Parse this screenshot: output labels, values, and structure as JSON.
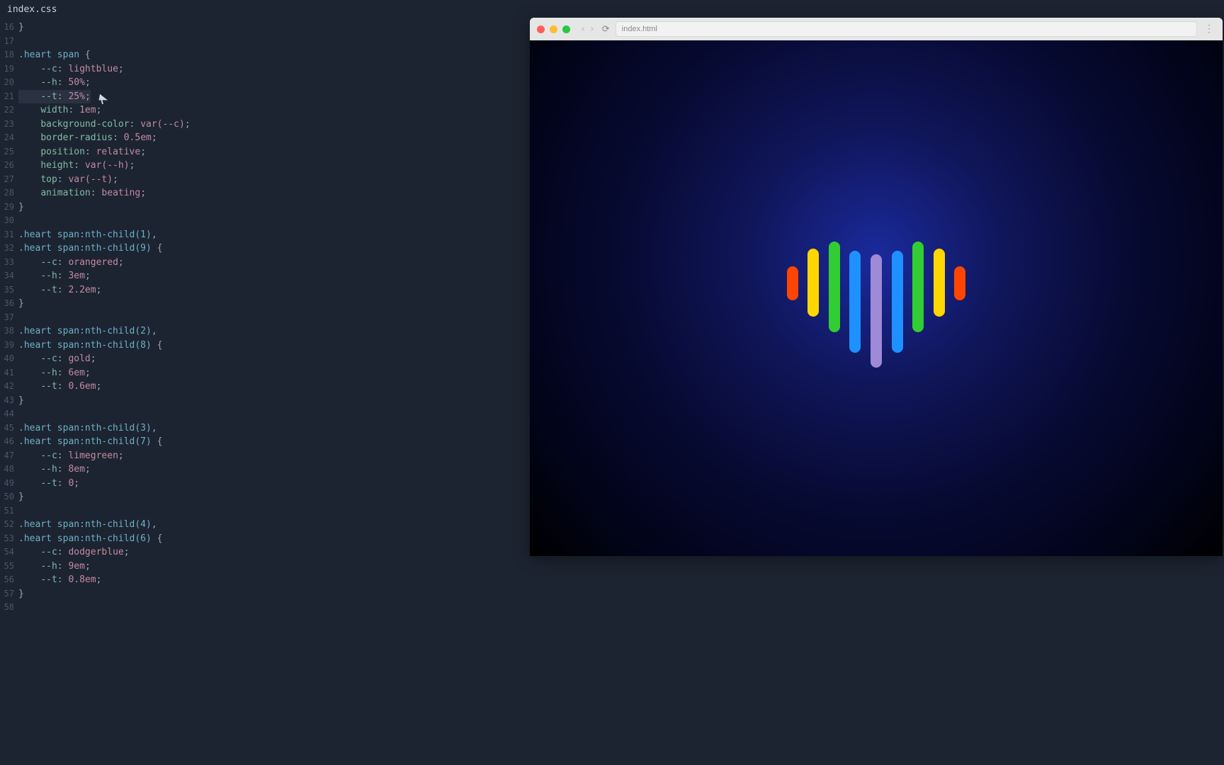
{
  "editor": {
    "tab_filename": "index.css",
    "active_line": 21,
    "lines": [
      {
        "n": 16,
        "segs": [
          {
            "t": "}",
            "c": "t-brace"
          }
        ]
      },
      {
        "n": 17,
        "segs": []
      },
      {
        "n": 18,
        "segs": [
          {
            "t": ".heart span",
            "c": "t-sel"
          },
          {
            "t": " {",
            "c": "t-brace"
          }
        ]
      },
      {
        "n": 19,
        "segs": [
          {
            "t": "    ",
            "c": ""
          },
          {
            "t": "--c",
            "c": "t-prop"
          },
          {
            "t": ": ",
            "c": "t-punct"
          },
          {
            "t": "lightblue",
            "c": "t-val"
          },
          {
            "t": ";",
            "c": "t-punct"
          }
        ]
      },
      {
        "n": 20,
        "segs": [
          {
            "t": "    ",
            "c": ""
          },
          {
            "t": "--h",
            "c": "t-prop"
          },
          {
            "t": ": ",
            "c": "t-punct"
          },
          {
            "t": "50%",
            "c": "t-val"
          },
          {
            "t": ";",
            "c": "t-punct"
          }
        ]
      },
      {
        "n": 21,
        "segs": [
          {
            "t": "    ",
            "c": ""
          },
          {
            "t": "--t",
            "c": "t-prop"
          },
          {
            "t": ": ",
            "c": "t-punct"
          },
          {
            "t": "25%",
            "c": "t-val"
          },
          {
            "t": ";",
            "c": "t-punct"
          }
        ],
        "hl": true
      },
      {
        "n": 22,
        "segs": [
          {
            "t": "    ",
            "c": ""
          },
          {
            "t": "width",
            "c": "t-prop"
          },
          {
            "t": ": ",
            "c": "t-punct"
          },
          {
            "t": "1em",
            "c": "t-val"
          },
          {
            "t": ";",
            "c": "t-punct"
          }
        ]
      },
      {
        "n": 23,
        "segs": [
          {
            "t": "    ",
            "c": ""
          },
          {
            "t": "background-color",
            "c": "t-prop"
          },
          {
            "t": ": ",
            "c": "t-punct"
          },
          {
            "t": "var(--c)",
            "c": "t-val"
          },
          {
            "t": ";",
            "c": "t-punct"
          }
        ]
      },
      {
        "n": 24,
        "segs": [
          {
            "t": "    ",
            "c": ""
          },
          {
            "t": "border-radius",
            "c": "t-prop"
          },
          {
            "t": ": ",
            "c": "t-punct"
          },
          {
            "t": "0.5em",
            "c": "t-val"
          },
          {
            "t": ";",
            "c": "t-punct"
          }
        ]
      },
      {
        "n": 25,
        "segs": [
          {
            "t": "    ",
            "c": ""
          },
          {
            "t": "position",
            "c": "t-prop"
          },
          {
            "t": ": ",
            "c": "t-punct"
          },
          {
            "t": "relative",
            "c": "t-val"
          },
          {
            "t": ";",
            "c": "t-punct"
          }
        ]
      },
      {
        "n": 26,
        "segs": [
          {
            "t": "    ",
            "c": ""
          },
          {
            "t": "height",
            "c": "t-prop"
          },
          {
            "t": ": ",
            "c": "t-punct"
          },
          {
            "t": "var(--h)",
            "c": "t-val"
          },
          {
            "t": ";",
            "c": "t-punct"
          }
        ]
      },
      {
        "n": 27,
        "segs": [
          {
            "t": "    ",
            "c": ""
          },
          {
            "t": "top",
            "c": "t-prop"
          },
          {
            "t": ": ",
            "c": "t-punct"
          },
          {
            "t": "var(--t)",
            "c": "t-val"
          },
          {
            "t": ";",
            "c": "t-punct"
          }
        ]
      },
      {
        "n": 28,
        "segs": [
          {
            "t": "    ",
            "c": ""
          },
          {
            "t": "animation",
            "c": "t-prop"
          },
          {
            "t": ": ",
            "c": "t-punct"
          },
          {
            "t": "beating",
            "c": "t-val"
          },
          {
            "t": ";",
            "c": "t-punct"
          }
        ]
      },
      {
        "n": 29,
        "segs": [
          {
            "t": "}",
            "c": "t-brace"
          }
        ]
      },
      {
        "n": 30,
        "segs": []
      },
      {
        "n": 31,
        "segs": [
          {
            "t": ".heart span:nth-child(1)",
            "c": "t-sel"
          },
          {
            "t": ",",
            "c": "t-punct"
          }
        ]
      },
      {
        "n": 32,
        "segs": [
          {
            "t": ".heart span:nth-child(9)",
            "c": "t-sel"
          },
          {
            "t": " {",
            "c": "t-brace"
          }
        ]
      },
      {
        "n": 33,
        "segs": [
          {
            "t": "    ",
            "c": ""
          },
          {
            "t": "--c",
            "c": "t-prop"
          },
          {
            "t": ": ",
            "c": "t-punct"
          },
          {
            "t": "orangered",
            "c": "t-val"
          },
          {
            "t": ";",
            "c": "t-punct"
          }
        ]
      },
      {
        "n": 34,
        "segs": [
          {
            "t": "    ",
            "c": ""
          },
          {
            "t": "--h",
            "c": "t-prop"
          },
          {
            "t": ": ",
            "c": "t-punct"
          },
          {
            "t": "3em",
            "c": "t-val"
          },
          {
            "t": ";",
            "c": "t-punct"
          }
        ]
      },
      {
        "n": 35,
        "segs": [
          {
            "t": "    ",
            "c": ""
          },
          {
            "t": "--t",
            "c": "t-prop"
          },
          {
            "t": ": ",
            "c": "t-punct"
          },
          {
            "t": "2.2em",
            "c": "t-val"
          },
          {
            "t": ";",
            "c": "t-punct"
          }
        ]
      },
      {
        "n": 36,
        "segs": [
          {
            "t": "}",
            "c": "t-brace"
          }
        ]
      },
      {
        "n": 37,
        "segs": []
      },
      {
        "n": 38,
        "segs": [
          {
            "t": ".heart span:nth-child(2)",
            "c": "t-sel"
          },
          {
            "t": ",",
            "c": "t-punct"
          }
        ]
      },
      {
        "n": 39,
        "segs": [
          {
            "t": ".heart span:nth-child(8)",
            "c": "t-sel"
          },
          {
            "t": " {",
            "c": "t-brace"
          }
        ]
      },
      {
        "n": 40,
        "segs": [
          {
            "t": "    ",
            "c": ""
          },
          {
            "t": "--c",
            "c": "t-prop"
          },
          {
            "t": ": ",
            "c": "t-punct"
          },
          {
            "t": "gold",
            "c": "t-val"
          },
          {
            "t": ";",
            "c": "t-punct"
          }
        ]
      },
      {
        "n": 41,
        "segs": [
          {
            "t": "    ",
            "c": ""
          },
          {
            "t": "--h",
            "c": "t-prop"
          },
          {
            "t": ": ",
            "c": "t-punct"
          },
          {
            "t": "6em",
            "c": "t-val"
          },
          {
            "t": ";",
            "c": "t-punct"
          }
        ]
      },
      {
        "n": 42,
        "segs": [
          {
            "t": "    ",
            "c": ""
          },
          {
            "t": "--t",
            "c": "t-prop"
          },
          {
            "t": ": ",
            "c": "t-punct"
          },
          {
            "t": "0.6em",
            "c": "t-val"
          },
          {
            "t": ";",
            "c": "t-punct"
          }
        ]
      },
      {
        "n": 43,
        "segs": [
          {
            "t": "}",
            "c": "t-brace"
          }
        ]
      },
      {
        "n": 44,
        "segs": []
      },
      {
        "n": 45,
        "segs": [
          {
            "t": ".heart span:nth-child(3)",
            "c": "t-sel"
          },
          {
            "t": ",",
            "c": "t-punct"
          }
        ]
      },
      {
        "n": 46,
        "segs": [
          {
            "t": ".heart span:nth-child(7)",
            "c": "t-sel"
          },
          {
            "t": " {",
            "c": "t-brace"
          }
        ]
      },
      {
        "n": 47,
        "segs": [
          {
            "t": "    ",
            "c": ""
          },
          {
            "t": "--c",
            "c": "t-prop"
          },
          {
            "t": ": ",
            "c": "t-punct"
          },
          {
            "t": "limegreen",
            "c": "t-val"
          },
          {
            "t": ";",
            "c": "t-punct"
          }
        ]
      },
      {
        "n": 48,
        "segs": [
          {
            "t": "    ",
            "c": ""
          },
          {
            "t": "--h",
            "c": "t-prop"
          },
          {
            "t": ": ",
            "c": "t-punct"
          },
          {
            "t": "8em",
            "c": "t-val"
          },
          {
            "t": ";",
            "c": "t-punct"
          }
        ]
      },
      {
        "n": 49,
        "segs": [
          {
            "t": "    ",
            "c": ""
          },
          {
            "t": "--t",
            "c": "t-prop"
          },
          {
            "t": ": ",
            "c": "t-punct"
          },
          {
            "t": "0",
            "c": "t-val"
          },
          {
            "t": ";",
            "c": "t-punct"
          }
        ]
      },
      {
        "n": 50,
        "segs": [
          {
            "t": "}",
            "c": "t-brace"
          }
        ]
      },
      {
        "n": 51,
        "segs": []
      },
      {
        "n": 52,
        "segs": [
          {
            "t": ".heart span:nth-child(4)",
            "c": "t-sel"
          },
          {
            "t": ",",
            "c": "t-punct"
          }
        ]
      },
      {
        "n": 53,
        "segs": [
          {
            "t": ".heart span:nth-child(6)",
            "c": "t-sel"
          },
          {
            "t": " {",
            "c": "t-brace"
          }
        ]
      },
      {
        "n": 54,
        "segs": [
          {
            "t": "    ",
            "c": ""
          },
          {
            "t": "--c",
            "c": "t-prop"
          },
          {
            "t": ": ",
            "c": "t-punct"
          },
          {
            "t": "dodgerblue",
            "c": "t-val"
          },
          {
            "t": ";",
            "c": "t-punct"
          }
        ]
      },
      {
        "n": 55,
        "segs": [
          {
            "t": "    ",
            "c": ""
          },
          {
            "t": "--h",
            "c": "t-prop"
          },
          {
            "t": ": ",
            "c": "t-punct"
          },
          {
            "t": "9em",
            "c": "t-val"
          },
          {
            "t": ";",
            "c": "t-punct"
          }
        ]
      },
      {
        "n": 56,
        "segs": [
          {
            "t": "    ",
            "c": ""
          },
          {
            "t": "--t",
            "c": "t-prop"
          },
          {
            "t": ": ",
            "c": "t-punct"
          },
          {
            "t": "0.8em",
            "c": "t-val"
          },
          {
            "t": ";",
            "c": "t-punct"
          }
        ]
      },
      {
        "n": 57,
        "segs": [
          {
            "t": "}",
            "c": "t-brace"
          }
        ]
      },
      {
        "n": 58,
        "segs": []
      }
    ]
  },
  "browser": {
    "address": "index.html",
    "nav_back": "‹",
    "nav_fwd": "›",
    "reload": "⟳",
    "menu_dots": "⋮"
  },
  "heart_bars": [
    {
      "color": "#ff4500",
      "h": "3em",
      "t": "2.2em"
    },
    {
      "color": "#ffd700",
      "h": "6em",
      "t": "0.6em"
    },
    {
      "color": "#32cd32",
      "h": "8em",
      "t": "0"
    },
    {
      "color": "#1e90ff",
      "h": "9em",
      "t": "0.8em"
    },
    {
      "color": "#9f8ad8",
      "h": "10em",
      "t": "1.1em"
    },
    {
      "color": "#1e90ff",
      "h": "9em",
      "t": "0.8em"
    },
    {
      "color": "#32cd32",
      "h": "8em",
      "t": "0"
    },
    {
      "color": "#ffd700",
      "h": "6em",
      "t": "0.6em"
    },
    {
      "color": "#ff4500",
      "h": "3em",
      "t": "2.2em"
    }
  ]
}
